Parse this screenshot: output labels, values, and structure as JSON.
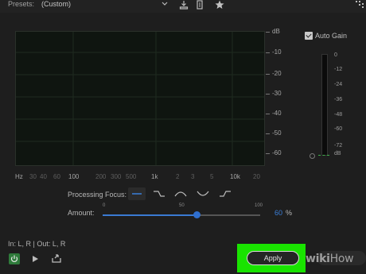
{
  "header": {
    "presets_label": "Presets:",
    "presets_value": "(Custom)",
    "icons": [
      "chevron-down-icon",
      "save-preset-icon",
      "delete-preset-icon",
      "favorite-star-icon",
      "routing-icon"
    ]
  },
  "graph": {
    "db_scale": [
      "dB",
      "-10",
      "-20",
      "-30",
      "-40",
      "-50",
      "-60"
    ],
    "freq_scale": [
      "Hz",
      "30",
      "40",
      "60",
      "100",
      "200",
      "300",
      "500",
      "1k",
      "2",
      "3",
      "5",
      "10k",
      "20"
    ]
  },
  "auto_gain": {
    "label": "Auto Gain",
    "checked": true,
    "meter_scale": [
      "0",
      "-12",
      "-24",
      "-36",
      "-48",
      "-60",
      "-72",
      "dB"
    ]
  },
  "processing_focus": {
    "label": "Processing Focus:",
    "options": [
      "flat-focus-icon",
      "high-cut-focus-icon",
      "mid-boost-focus-icon",
      "mid-cut-focus-icon",
      "low-cut-focus-icon"
    ],
    "selected_index": 0
  },
  "amount": {
    "label": "Amount:",
    "value": "60",
    "unit": "%",
    "fraction": 0.6,
    "ticks": [
      "0",
      "50",
      "100"
    ]
  },
  "footer": {
    "io": "In: L, R | Out: L, R",
    "apply_label": "Apply",
    "watermark_a": "wiki",
    "watermark_b": "How"
  },
  "colors": {
    "accent": "#3b7fd9",
    "highlight": "#19e300",
    "power": "#2f7b3b"
  }
}
